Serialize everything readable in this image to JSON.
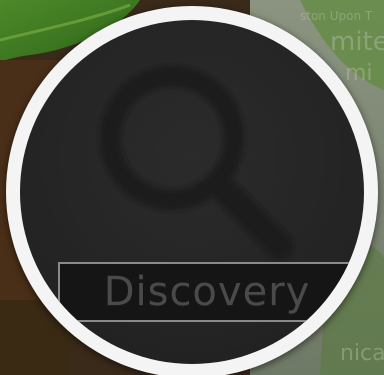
{
  "tile": {
    "label": "Discovery",
    "icon": "search-icon"
  },
  "colors": {
    "ring": "#f4f4f4",
    "disc": "#232323",
    "label_text": "#4a4a4a",
    "label_border": "#8a8a8a"
  }
}
